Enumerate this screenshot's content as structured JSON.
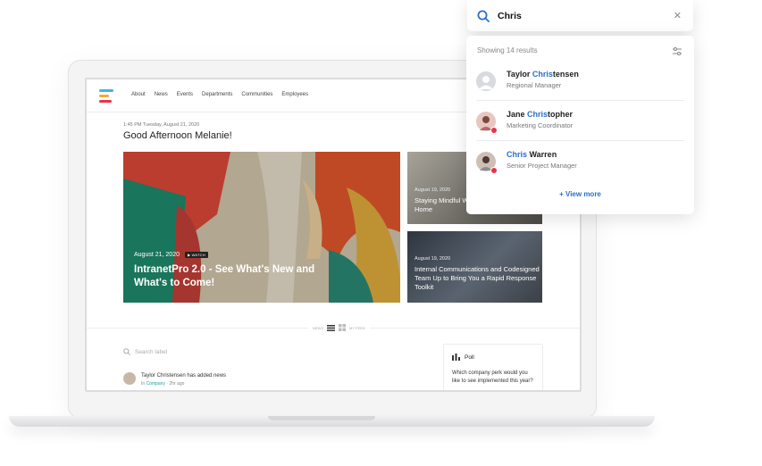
{
  "intranet": {
    "nav": [
      "About",
      "News",
      "Events",
      "Departments",
      "Communities",
      "Employees"
    ],
    "greeting_time": "1:45 PM   Tuesday, August 21, 2020",
    "greeting": "Good Afternoon Melanie!",
    "hero": {
      "date": "August 21, 2020",
      "badge": "▶ WATCH",
      "title": "IntranetPro 2.0 - See What's New and What's to Come!"
    },
    "side_cards": [
      {
        "date": "August 19, 2020",
        "title": "Staying Mindful While Working From Home"
      },
      {
        "date": "August 19, 2020",
        "title": "Internal Communications and Codesigned Team Up to Bring You a Rapid Response Toolkit"
      }
    ],
    "view_toggle": {
      "left": "NEWS",
      "right": "MY FEED"
    },
    "search_label_placeholder": "Search label",
    "activity": {
      "actor": "Taylor Christensen",
      "action": "has added news",
      "in_label": "In",
      "group": "Company",
      "time": "2hr ago"
    },
    "poll": {
      "title": "Poll",
      "question": "Which company perk would you like to see implemented this year?"
    }
  },
  "search": {
    "query": "Chris",
    "result_count": "Showing 14 results",
    "results": [
      {
        "name_pre": "Taylor ",
        "name_hl": "Chris",
        "name_post": "tensen",
        "role": "Regional Manager"
      },
      {
        "name_pre": "Jane ",
        "name_hl": "Chris",
        "name_post": "topher",
        "role": "Marketing Coordinator"
      },
      {
        "name_pre": "",
        "name_hl": "Chris",
        "name_post": " Warren",
        "role": "Senior Project Manager"
      }
    ],
    "view_more": "+ View more"
  },
  "colors": {
    "accent": "#2a6fc9",
    "status_dot": "#e8334a",
    "link": "#1fa3a3"
  }
}
